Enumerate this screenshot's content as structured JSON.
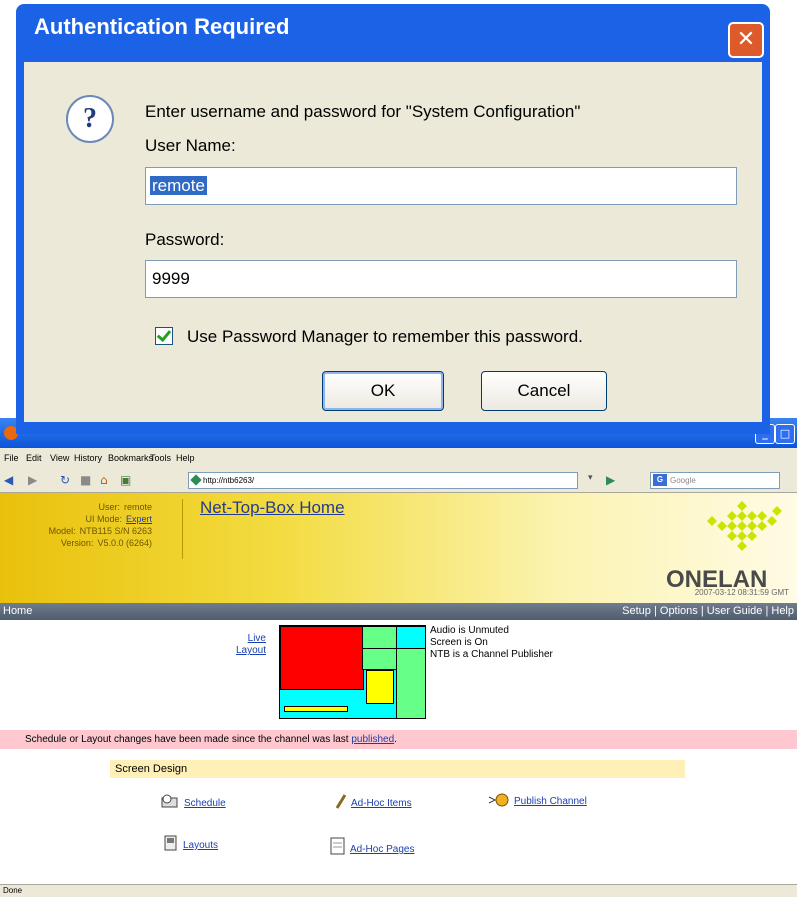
{
  "dialog": {
    "title": "Authentication Required",
    "close_glyph": "✕",
    "prompt": "Enter username and password for \"System Configuration\"",
    "username_label": "User Name:",
    "username_value": "remote",
    "password_label": "Password:",
    "password_value": "9999",
    "remember_label": "Use Password Manager to remember this password.",
    "remember_checked": true,
    "ok_label": "OK",
    "cancel_label": "Cancel",
    "icon": "question-icon"
  },
  "browser": {
    "menu": [
      "File",
      "Edit",
      "View",
      "History",
      "Bookmarks",
      "Tools",
      "Help"
    ],
    "url": "http://ntb6263/",
    "search_placeholder": "Google",
    "status": "Done"
  },
  "page": {
    "info": {
      "user_label": "User:",
      "user_value": "remote",
      "mode_label": "UI Mode:",
      "mode_value": "Expert",
      "model_label": "Model:",
      "model_value": "NTB115 S/N 6263",
      "version_label": "Version:",
      "version_value": "V5.0.0 (6264)"
    },
    "title": "Net-Top-Box Home",
    "brand": "ONELAN",
    "timestamp": "2007-03-12 08:31:59 GMT",
    "nav_home": "Home",
    "nav_right": "Setup | Options | User Guide | Help",
    "live_link": "Live",
    "layout_link": "Layout",
    "status_lines": [
      "Audio is Unmuted",
      "Screen is On",
      "NTB is a Channel Publisher"
    ],
    "notice_text": "Schedule or Layout changes have been made since the channel was last ",
    "notice_link": "published",
    "notice_end": ".",
    "screen_design_title": "Screen Design",
    "items": {
      "schedule": "Schedule",
      "adhoc_items": "Ad-Hoc Items",
      "publish": "Publish Channel",
      "layouts": "Layouts",
      "adhoc_pages": "Ad-Hoc Pages"
    },
    "colors": {
      "header_yellow": "#f3dc40",
      "nav_bar": "#5f6d7e",
      "notice_pink": "#ffc8d0",
      "link_blue": "#1a3fb0"
    }
  }
}
